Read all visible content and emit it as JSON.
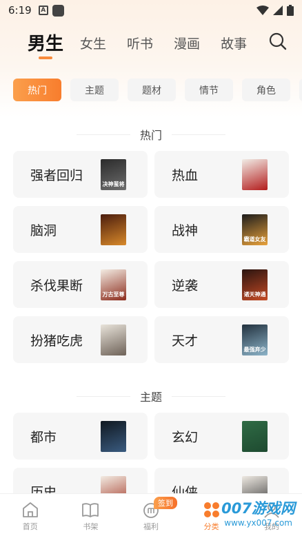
{
  "status_bar": {
    "time": "6:19",
    "app_icon_letter": "A"
  },
  "top_tabs": [
    {
      "label": "男生",
      "active": true
    },
    {
      "label": "女生",
      "active": false
    },
    {
      "label": "听书",
      "active": false
    },
    {
      "label": "漫画",
      "active": false
    },
    {
      "label": "故事",
      "active": false
    }
  ],
  "filter_chips": [
    {
      "label": "热门",
      "active": true
    },
    {
      "label": "主题",
      "active": false
    },
    {
      "label": "题材",
      "active": false
    },
    {
      "label": "情节",
      "active": false
    },
    {
      "label": "角色",
      "active": false
    }
  ],
  "sections": [
    {
      "title": "热门",
      "items": [
        {
          "label": "强者回归",
          "cover_text": "决神蜚将",
          "cover_colors": [
            "#2b2b2b",
            "#6d6d6d"
          ]
        },
        {
          "label": "热血",
          "cover_text": "",
          "cover_colors": [
            "#f1ece6",
            "#b31c1c"
          ]
        },
        {
          "label": "脑洞",
          "cover_text": "",
          "cover_colors": [
            "#4b1d0e",
            "#d8892a"
          ]
        },
        {
          "label": "战神",
          "cover_text": "霸道女友",
          "cover_colors": [
            "#1c1c1c",
            "#e9a23b"
          ]
        },
        {
          "label": "杀伐果断",
          "cover_text": "万古至尊",
          "cover_colors": [
            "#f3ece3",
            "#8b2b1c"
          ]
        },
        {
          "label": "逆袭",
          "cover_text": "诸天神通",
          "cover_colors": [
            "#2a1410",
            "#c54a24"
          ]
        },
        {
          "label": "扮猪吃虎",
          "cover_text": "",
          "cover_colors": [
            "#e8e3da",
            "#6e6258"
          ]
        },
        {
          "label": "天才",
          "cover_text": "最强弃少",
          "cover_colors": [
            "#22313e",
            "#8db4c9"
          ]
        }
      ]
    },
    {
      "title": "主题",
      "items": [
        {
          "label": "都市",
          "cover_text": "",
          "cover_colors": [
            "#101820",
            "#3a5b80"
          ]
        },
        {
          "label": "玄幻",
          "cover_text": "",
          "cover_colors": [
            "#2f6b45",
            "#1e4a30"
          ]
        },
        {
          "label": "历史",
          "cover_text": "",
          "cover_colors": [
            "#f2ebe2",
            "#a33a2a"
          ]
        },
        {
          "label": "仙侠",
          "cover_text": "",
          "cover_colors": [
            "#eee9e2",
            "#3c3c3c"
          ]
        }
      ]
    }
  ],
  "bottom_nav": [
    {
      "label": "首页",
      "icon": "home-icon",
      "active": false
    },
    {
      "label": "书架",
      "icon": "book-icon",
      "active": false
    },
    {
      "label": "福利",
      "icon": "gift-icon",
      "active": false,
      "badge": "签到"
    },
    {
      "label": "分类",
      "icon": "category-icon",
      "active": true
    },
    {
      "label": "我的",
      "icon": "user-icon",
      "active": false
    }
  ],
  "watermark": {
    "main": "007游戏网",
    "sub": "www.yx007.com"
  },
  "colors": {
    "accent": "#f87d2d",
    "card_bg": "#f6f6f6",
    "chip_bg": "#f4f4f4"
  }
}
